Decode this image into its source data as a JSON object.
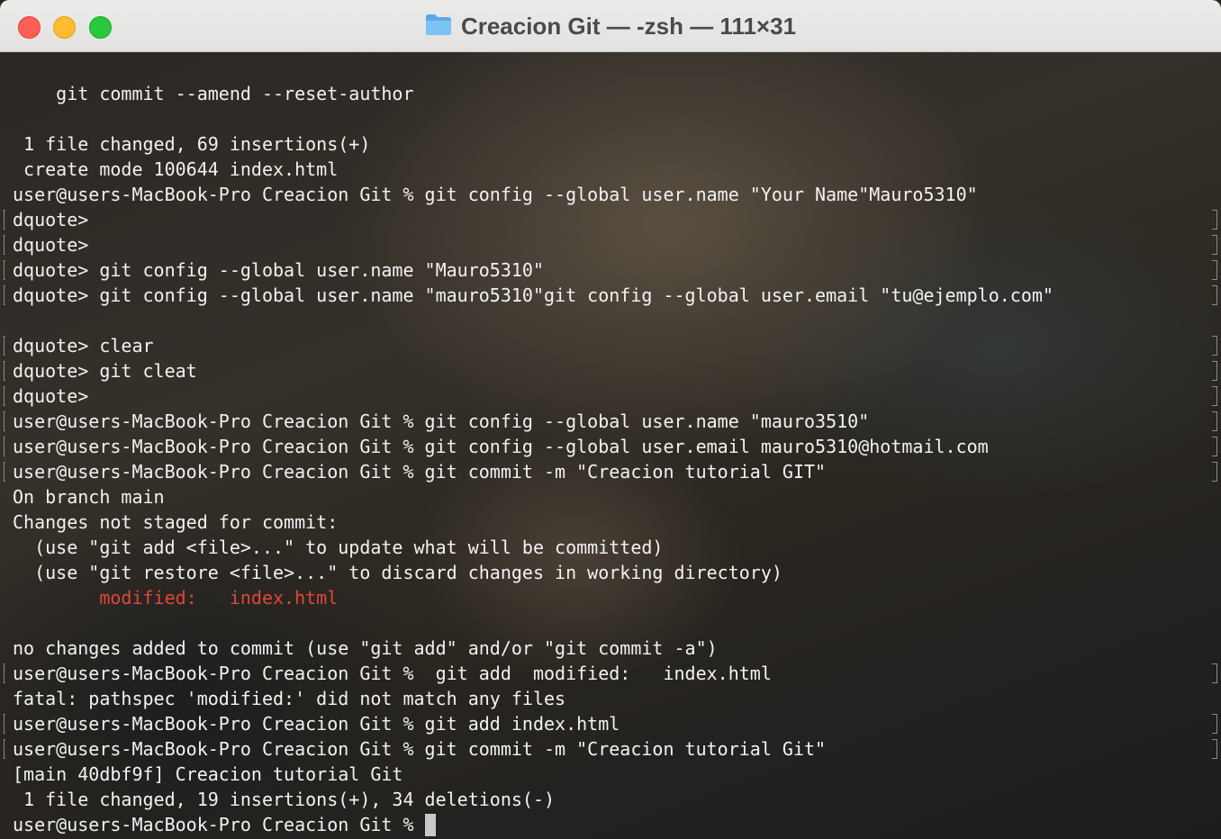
{
  "window": {
    "title": "Creacion Git — -zsh — 111×31",
    "title_icon": "folder-icon"
  },
  "terminal": {
    "lines": [
      {
        "text": "    git commit --amend --reset-author",
        "marked": false
      },
      {
        "text": "",
        "marked": false
      },
      {
        "text": " 1 file changed, 69 insertions(+)",
        "marked": false
      },
      {
        "text": " create mode 100644 index.html",
        "marked": false
      },
      {
        "text": "user@users-MacBook-Pro Creacion Git % git config --global user.name \"Your Name\"Mauro5310\"",
        "marked": false
      },
      {
        "text": "dquote>",
        "marked": true
      },
      {
        "text": "dquote>",
        "marked": true
      },
      {
        "text": "dquote> git config --global user.name \"Mauro5310\"",
        "marked": true
      },
      {
        "text": "dquote> git config --global user.name \"mauro5310\"git config --global user.email \"tu@ejemplo.com\"",
        "marked": true
      },
      {
        "text": "",
        "marked": false
      },
      {
        "text": "dquote> clear",
        "marked": true
      },
      {
        "text": "dquote> git cleat",
        "marked": true
      },
      {
        "text": "dquote>",
        "marked": true
      },
      {
        "text": "user@users-MacBook-Pro Creacion Git % git config --global user.name \"mauro3510\"",
        "marked": true
      },
      {
        "text": "user@users-MacBook-Pro Creacion Git % git config --global user.email mauro5310@hotmail.com",
        "marked": true
      },
      {
        "text": "user@users-MacBook-Pro Creacion Git % git commit -m \"Creacion tutorial GIT\"",
        "marked": true
      },
      {
        "text": "On branch main",
        "marked": false
      },
      {
        "text": "Changes not staged for commit:",
        "marked": false
      },
      {
        "text": "  (use \"git add <file>...\" to update what will be committed)",
        "marked": false
      },
      {
        "text": "  (use \"git restore <file>...\" to discard changes in working directory)",
        "marked": false
      },
      {
        "text": "",
        "indent": "        ",
        "red": "modified:   index.html",
        "marked": false
      },
      {
        "text": "",
        "marked": false
      },
      {
        "text": "no changes added to commit (use \"git add\" and/or \"git commit -a\")",
        "marked": false
      },
      {
        "text": "user@users-MacBook-Pro Creacion Git %  git add  modified:   index.html",
        "marked": true
      },
      {
        "text": "fatal: pathspec 'modified:' did not match any files",
        "marked": false
      },
      {
        "text": "user@users-MacBook-Pro Creacion Git % git add index.html",
        "marked": true
      },
      {
        "text": "user@users-MacBook-Pro Creacion Git % git commit -m \"Creacion tutorial Git\"",
        "marked": true
      },
      {
        "text": "[main 40dbf9f] Creacion tutorial Git",
        "marked": false
      },
      {
        "text": " 1 file changed, 19 insertions(+), 34 deletions(-)",
        "marked": false
      },
      {
        "text": "user@users-MacBook-Pro Creacion Git % ",
        "marked": false,
        "cursor": true
      }
    ]
  }
}
